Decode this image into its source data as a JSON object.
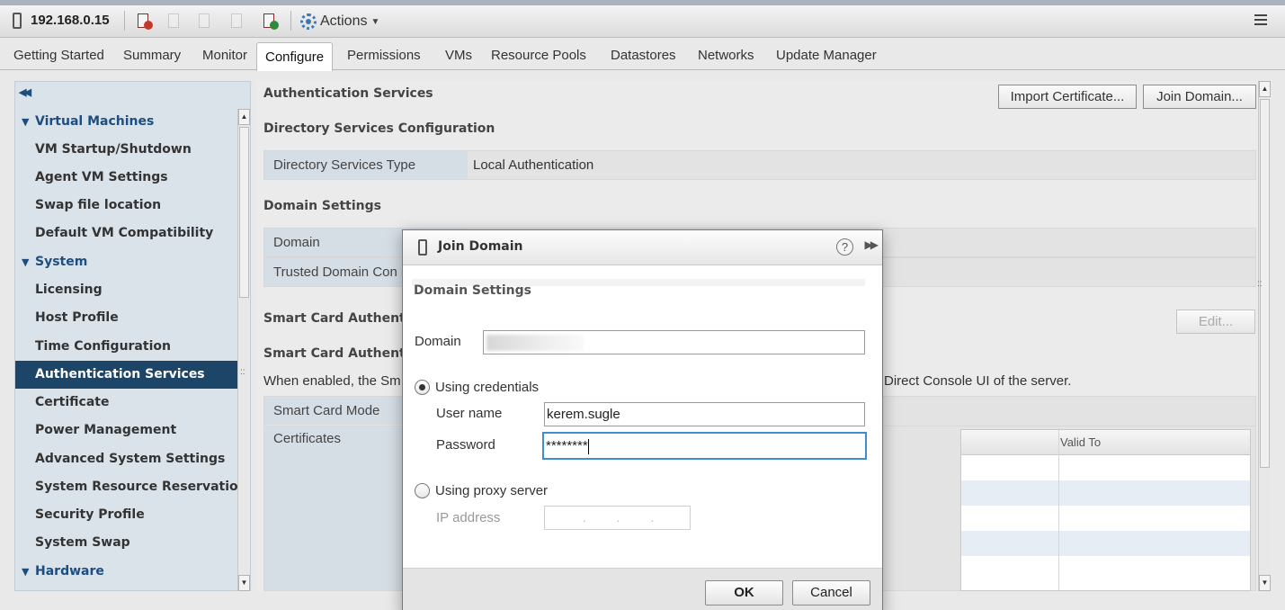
{
  "header": {
    "host": "192.168.0.15",
    "actions_label": "Actions",
    "toolbar_icons": [
      "power-off-icon",
      "suspend-icon",
      "shutdown-icon",
      "reboot-icon",
      "enter-maintenance-icon"
    ]
  },
  "tabs": [
    {
      "label": "Getting Started"
    },
    {
      "label": "Summary"
    },
    {
      "label": "Monitor"
    },
    {
      "label": "Configure"
    },
    {
      "label": "Permissions"
    },
    {
      "label": "VMs"
    },
    {
      "label": "Resource Pools"
    },
    {
      "label": "Datastores"
    },
    {
      "label": "Networks"
    },
    {
      "label": "Update Manager"
    }
  ],
  "active_tab": "Configure",
  "sidebar": {
    "items": [
      {
        "label": "Virtual Machines",
        "group": true
      },
      {
        "label": "VM Startup/Shutdown"
      },
      {
        "label": "Agent VM Settings"
      },
      {
        "label": "Swap file location"
      },
      {
        "label": "Default VM Compatibility"
      },
      {
        "label": "System",
        "group": true
      },
      {
        "label": "Licensing"
      },
      {
        "label": "Host Profile"
      },
      {
        "label": "Time Configuration"
      },
      {
        "label": "Authentication Services",
        "selected": true
      },
      {
        "label": "Certificate"
      },
      {
        "label": "Power Management"
      },
      {
        "label": "Advanced System Settings"
      },
      {
        "label": "System Resource Reservation"
      },
      {
        "label": "Security Profile"
      },
      {
        "label": "System Swap"
      },
      {
        "label": "Hardware",
        "group": true
      }
    ]
  },
  "main": {
    "title": "Authentication Services",
    "import_cert_label": "Import Certificate...",
    "join_domain_label": "Join Domain...",
    "dir_config_title": "Directory Services Configuration",
    "dir_type_label": "Directory Services Type",
    "dir_type_value": "Local Authentication",
    "domain_settings_title": "Domain Settings",
    "domain_label": "Domain",
    "trusted_label": "Trusted Domain Con",
    "smart_card_title_1": "Smart Card Authentic",
    "smart_card_title_2": "Smart Card Authentic",
    "edit_label": "Edit...",
    "desc_left": "When enabled, the Sm",
    "desc_right": "Direct Console UI of the server.",
    "smart_card_mode_label": "Smart Card Mode",
    "certificates_label": "Certificates",
    "valid_to_header": "Valid To"
  },
  "dialog": {
    "title": "Join Domain",
    "section": "Domain Settings",
    "domain_label": "Domain",
    "using_credentials": "Using credentials",
    "username_label": "User name",
    "username_value": "kerem.sugle",
    "password_label": "Password",
    "password_value": "********",
    "using_proxy": "Using proxy server",
    "ip_label": "IP address",
    "ip_placeholder": ". . .",
    "ok_label": "OK",
    "cancel_label": "Cancel"
  },
  "colors": {
    "selected_nav": "#1c4567",
    "group_text": "#1d4e7f",
    "focus_border": "#3e8ed0"
  }
}
